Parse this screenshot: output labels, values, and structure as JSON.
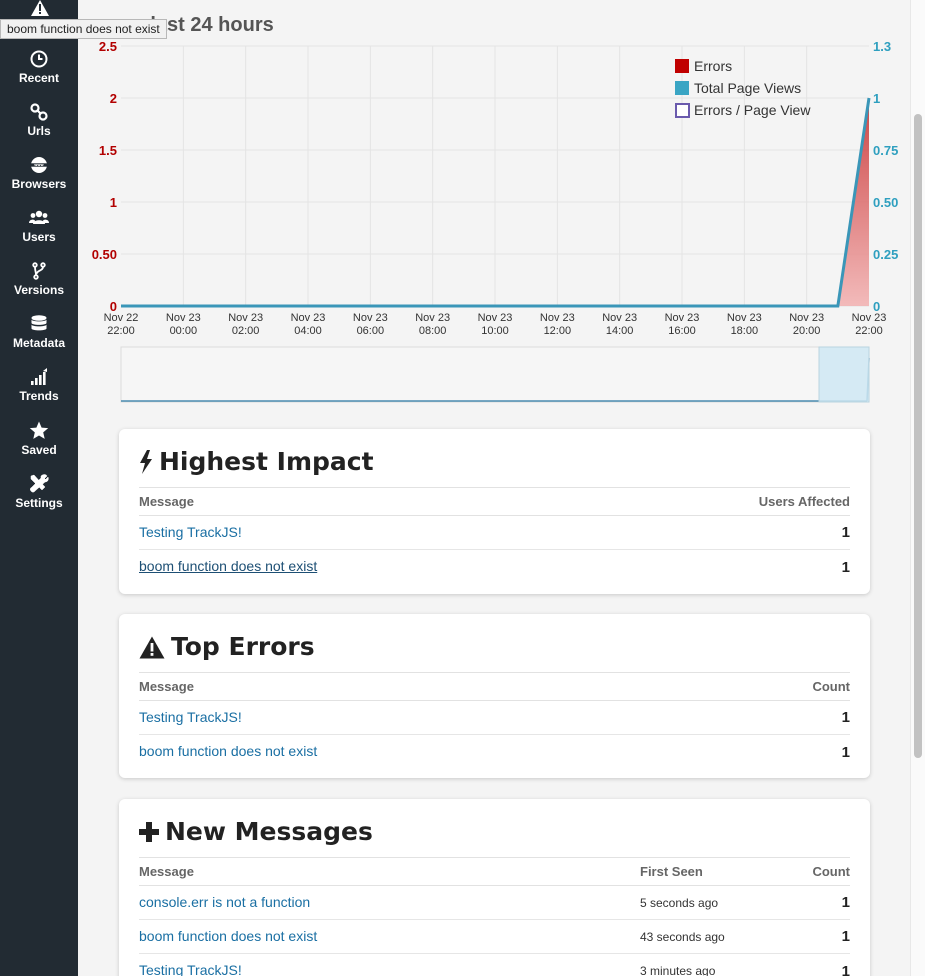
{
  "tooltip": "boom function does not exist",
  "nav": [
    {
      "label": "Recent",
      "icon": "clock-icon"
    },
    {
      "label": "Urls",
      "icon": "link-icon"
    },
    {
      "label": "Browsers",
      "icon": "globe-icon"
    },
    {
      "label": "Users",
      "icon": "users-icon"
    },
    {
      "label": "Versions",
      "icon": "branch-icon"
    },
    {
      "label": "Metadata",
      "icon": "database-icon"
    },
    {
      "label": "Trends",
      "icon": "trends-icon"
    },
    {
      "label": "Saved",
      "icon": "star-icon"
    },
    {
      "label": "Settings",
      "icon": "tools-icon"
    }
  ],
  "chart": {
    "title_visible": "r last 24 hours"
  },
  "chart_data": {
    "type": "area",
    "x": [
      [
        "Nov 22",
        "22:00"
      ],
      [
        "Nov 23",
        "00:00"
      ],
      [
        "Nov 23",
        "02:00"
      ],
      [
        "Nov 23",
        "04:00"
      ],
      [
        "Nov 23",
        "06:00"
      ],
      [
        "Nov 23",
        "08:00"
      ],
      [
        "Nov 23",
        "10:00"
      ],
      [
        "Nov 23",
        "12:00"
      ],
      [
        "Nov 23",
        "14:00"
      ],
      [
        "Nov 23",
        "16:00"
      ],
      [
        "Nov 23",
        "18:00"
      ],
      [
        "Nov 23",
        "20:00"
      ],
      [
        "Nov 23",
        "22:00"
      ]
    ],
    "y_left_ticks": [
      "0",
      "0.50",
      "1",
      "1.5",
      "2",
      "2.5"
    ],
    "y_left_values": [
      0,
      0.5,
      1,
      1.5,
      2,
      2.5
    ],
    "y_right_ticks": [
      "0",
      "0.25",
      "0.50",
      "0.75",
      "1",
      "1.3"
    ],
    "y_right_values": [
      0,
      0.25,
      0.5,
      0.75,
      1,
      1.25
    ],
    "ylim_left": [
      0,
      2.5
    ],
    "ylim_right": [
      0,
      1.25
    ],
    "grid": true,
    "legend_position": "top-right",
    "legend": [
      {
        "name": "Errors",
        "color": "#c00000",
        "style": "filled"
      },
      {
        "name": "Total Page Views",
        "color": "#3aa5c4",
        "style": "filled"
      },
      {
        "name": "Errors / Page View",
        "color": "#6a5aad",
        "style": "outline"
      }
    ],
    "series": [
      {
        "name": "Errors",
        "axis": "left",
        "x": [
          0,
          11.5,
          12
        ],
        "values": [
          0,
          0,
          2
        ]
      },
      {
        "name": "Total Page Views",
        "axis": "right",
        "x": [
          0,
          11.5,
          12
        ],
        "values": [
          0,
          0,
          1
        ]
      }
    ],
    "colors": {
      "left_axis": "#b20000",
      "right_axis": "#2e9fbf"
    }
  },
  "highest_impact": {
    "title": "Highest Impact",
    "col_message": "Message",
    "col_users": "Users Affected",
    "rows": [
      {
        "message": "Testing TrackJS!",
        "users": "1"
      },
      {
        "message": "boom function does not exist",
        "users": "1"
      }
    ]
  },
  "top_errors": {
    "title": "Top Errors",
    "col_message": "Message",
    "col_count": "Count",
    "rows": [
      {
        "message": "Testing TrackJS!",
        "count": "1"
      },
      {
        "message": "boom function does not exist",
        "count": "1"
      }
    ]
  },
  "new_messages": {
    "title": "New Messages",
    "col_message": "Message",
    "col_first_seen": "First Seen",
    "col_count": "Count",
    "rows": [
      {
        "message": "console.err is not a function",
        "first_seen": "5 seconds ago",
        "count": "1"
      },
      {
        "message": "boom function does not exist",
        "first_seen": "43 seconds ago",
        "count": "1"
      },
      {
        "message": "Testing TrackJS!",
        "first_seen": "3 minutes ago",
        "count": "1"
      }
    ]
  }
}
